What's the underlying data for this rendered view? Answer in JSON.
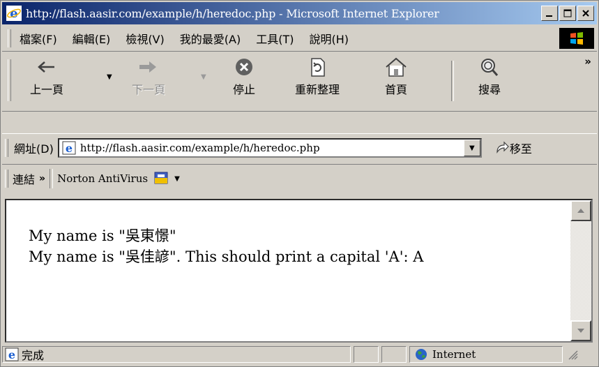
{
  "window": {
    "title": "http://flash.aasir.com/example/h/heredoc.php - Microsoft Internet Explorer"
  },
  "menu": {
    "items": [
      "檔案(F)",
      "編輯(E)",
      "檢視(V)",
      "我的最愛(A)",
      "工具(T)",
      "說明(H)"
    ]
  },
  "toolbar": {
    "back_label": "上一頁",
    "forward_label": "下一頁",
    "stop_label": "停止",
    "refresh_label": "重新整理",
    "home_label": "首頁",
    "search_label": "搜尋",
    "more": "»"
  },
  "address": {
    "label": "網址(D)",
    "value": "http://flash.aasir.com/example/h/heredoc.php",
    "go_label": "移至"
  },
  "links": {
    "label": "連結",
    "chevron": "»",
    "norton_label": "Norton AntiVirus"
  },
  "content": {
    "line1": "My name is \"吳東憬\"",
    "line2": "My name is \"吳佳諺\". This should print a capital 'A': A"
  },
  "status": {
    "text": "完成",
    "zone": "Internet"
  }
}
